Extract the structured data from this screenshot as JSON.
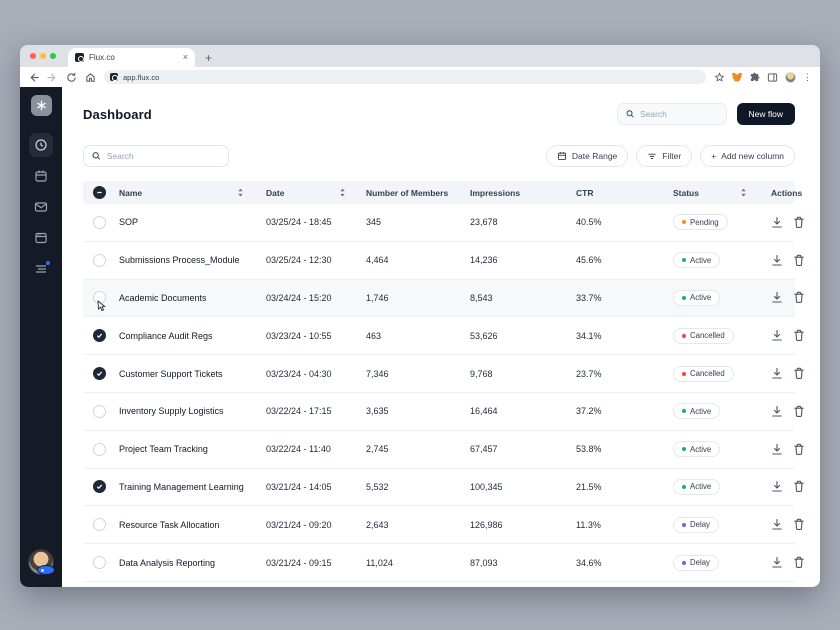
{
  "browser": {
    "tab_title": "Flux.co",
    "url": "app.flux.co",
    "close_glyph": "×",
    "new_tab_glyph": "+",
    "menu_glyph": "⋮"
  },
  "sidebar": {
    "active_item": "dashboard",
    "items": [
      "logo",
      "dashboard",
      "calendar",
      "mail",
      "window",
      "tasks"
    ],
    "tasks_has_notification": true
  },
  "header": {
    "title": "Dashboard",
    "search_placeholder": "Search",
    "new_flow_label": "New flow"
  },
  "toolbar": {
    "search_placeholder": "Search",
    "date_range_label": "Date Range",
    "filter_label": "Filter",
    "add_column_plus": "+",
    "add_column_label": "Add new column"
  },
  "table": {
    "columns": [
      {
        "label": "Name",
        "sortable": true
      },
      {
        "label": "Date",
        "sortable": true
      },
      {
        "label": "Number of Members",
        "sortable": false
      },
      {
        "label": "Impressions",
        "sortable": false
      },
      {
        "label": "CTR",
        "sortable": false
      },
      {
        "label": "Status",
        "sortable": true
      },
      {
        "label": "Actions",
        "sortable": false
      }
    ],
    "header_checkbox_state": "indeterminate",
    "rows": [
      {
        "name": "SOP",
        "date": "03/25/24 - 18:45",
        "members": "345",
        "impressions": "23,678",
        "ctr": "40.5%",
        "status": "Pending",
        "checked": false,
        "hovered": false,
        "cursor": false
      },
      {
        "name": "Submissions Process_Module",
        "date": "03/25/24 - 12:30",
        "members": "4,464",
        "impressions": "14,236",
        "ctr": "45.6%",
        "status": "Active",
        "checked": false,
        "hovered": false,
        "cursor": false
      },
      {
        "name": "Academic Documents",
        "date": "03/24/24 - 15:20",
        "members": "1,746",
        "impressions": "8,543",
        "ctr": "33.7%",
        "status": "Active",
        "checked": false,
        "hovered": true,
        "cursor": true
      },
      {
        "name": "Compliance Audit Regs",
        "date": "03/23/24 - 10:55",
        "members": "463",
        "impressions": "53,626",
        "ctr": "34.1%",
        "status": "Cancelled",
        "checked": true,
        "hovered": false,
        "cursor": false
      },
      {
        "name": "Customer Support Tickets",
        "date": "03/23/24 - 04:30",
        "members": "7,346",
        "impressions": "9,768",
        "ctr": "23.7%",
        "status": "Cancelled",
        "checked": true,
        "hovered": false,
        "cursor": false
      },
      {
        "name": "Inventory Supply Logistics",
        "date": "03/22/24 - 17:15",
        "members": "3,635",
        "impressions": "16,464",
        "ctr": "37.2%",
        "status": "Active",
        "checked": false,
        "hovered": false,
        "cursor": false
      },
      {
        "name": "Project Team Tracking",
        "date": "03/22/24 - 11:40",
        "members": "2,745",
        "impressions": "67,457",
        "ctr": "53.8%",
        "status": "Active",
        "checked": false,
        "hovered": false,
        "cursor": false
      },
      {
        "name": "Training Management Learning",
        "date": "03/21/24 - 14:05",
        "members": "5,532",
        "impressions": "100,345",
        "ctr": "21.5%",
        "status": "Active",
        "checked": true,
        "hovered": false,
        "cursor": false
      },
      {
        "name": "Resource Task Allocation",
        "date": "03/21/24 - 09:20",
        "members": "2,643",
        "impressions": "126,986",
        "ctr": "11.3%",
        "status": "Delay",
        "checked": false,
        "hovered": false,
        "cursor": false
      },
      {
        "name": "Data Analysis Reporting",
        "date": "03/21/24 - 09:15",
        "members": "11,024",
        "impressions": "87,093",
        "ctr": "34.6%",
        "status": "Delay",
        "checked": false,
        "hovered": false,
        "cursor": false
      }
    ]
  },
  "status_colors": {
    "Pending": "#f79009",
    "Active": "#12b76a",
    "Cancelled": "#f04438",
    "Delay": "#7a5af8"
  },
  "colors": {
    "canvas": "#a8adb8",
    "sidebar": "#151b26",
    "primary_button": "#101828",
    "table_header_bg": "#f2f4f7",
    "notification_blue": "#2e6bff"
  }
}
